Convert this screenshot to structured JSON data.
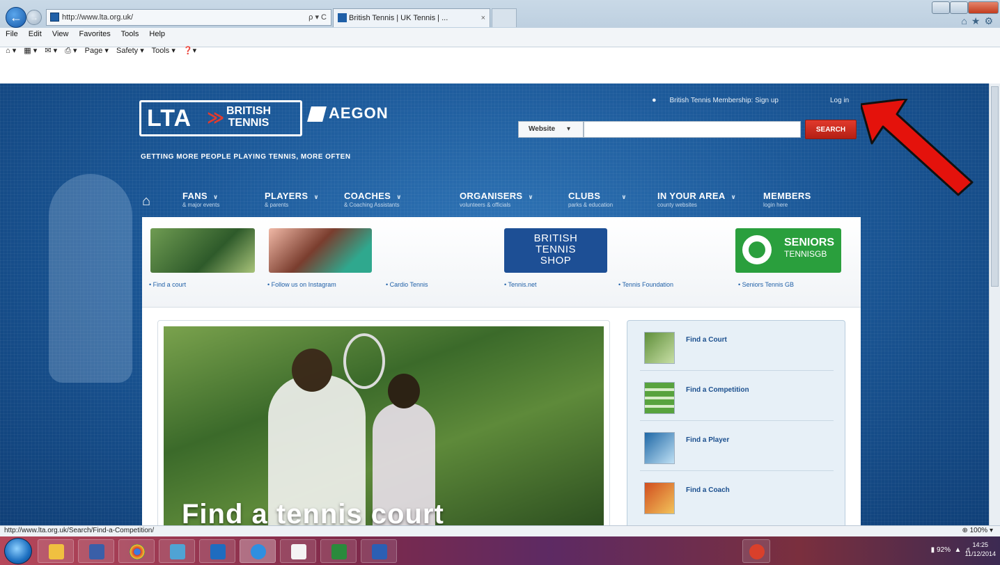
{
  "browser": {
    "address_url": "http://www.lta.org.uk/",
    "address_controls": "ρ ▾ C",
    "tab_title": "British Tennis | UK Tennis | ...",
    "tab_close": "×",
    "menu": [
      "File",
      "Edit",
      "View",
      "Favorites",
      "Tools",
      "Help"
    ],
    "commands": [
      "Page ▾",
      "Safety ▾",
      "Tools ▾"
    ],
    "status_url": "http://www.lta.org.uk/Search/Find-a-Competition/",
    "zoom": "100%"
  },
  "site": {
    "logo_lta": "LTA",
    "logo_british": "BRITISH",
    "logo_tennis": "TENNIS",
    "logo_aegon": "AEGON",
    "tagline": "GETTING MORE PEOPLE PLAYING TENNIS, MORE OFTEN",
    "membership_text": "British Tennis Membership: Sign up",
    "login": "Log in",
    "search": {
      "scope": "Website",
      "placeholder": "",
      "button": "SEARCH"
    },
    "nav": [
      {
        "title": "FANS",
        "sub": "& major events"
      },
      {
        "title": "PLAYERS",
        "sub": "& parents"
      },
      {
        "title": "COACHES",
        "sub": "& Coaching Assistants"
      },
      {
        "title": "ORGANISERS",
        "sub": "volunteers & officials"
      },
      {
        "title": "CLUBS",
        "sub": "parks & education"
      },
      {
        "title": "IN YOUR AREA",
        "sub": "county websites"
      },
      {
        "title": "MEMBERS",
        "sub": "login here"
      }
    ],
    "promo_links": [
      "• Find a court",
      "• Follow us on Instagram",
      "• Cardio Tennis",
      "• Tennis.net",
      "• Tennis Foundation",
      "• Seniors Tennis GB"
    ],
    "shop_lines": [
      "BRITISH",
      "TENNIS",
      "SHOP"
    ],
    "seniors_title": "SENIORS",
    "seniors_sub": "TENNISGB",
    "hero_title": "Find a tennis court",
    "side_items": [
      "Find a Court",
      "Find a Competition",
      "Find a Player",
      "Find a Coach"
    ]
  },
  "taskbar": {
    "battery": "92%",
    "time": "14:25",
    "date": "11/12/2014"
  },
  "colors": {
    "page_blue": "#1b5898",
    "search_red": "#c9271c",
    "annotation_arrow": "#e4120c"
  }
}
